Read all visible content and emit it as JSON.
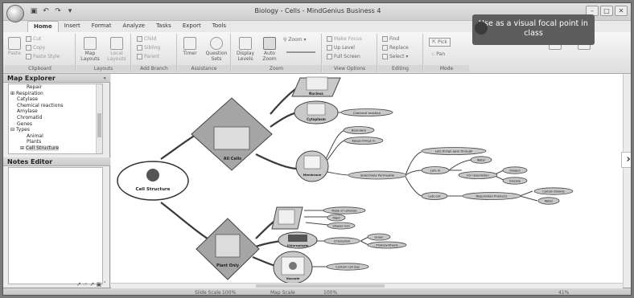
{
  "window": {
    "title": "Biology - Cells - MindGenius Business 4",
    "controls": [
      "–",
      "□",
      "✕"
    ]
  },
  "quick_access": [
    "save-icon",
    "undo-icon",
    "redo-icon"
  ],
  "tabs": [
    "Home",
    "Insert",
    "Format",
    "Analyze",
    "Tasks",
    "Export",
    "Tools"
  ],
  "ribbon": {
    "clipboard": {
      "paste": "Paste",
      "cut": "Cut",
      "copy": "Copy",
      "paste_style": "Paste Style",
      "label": "Clipboard"
    },
    "layouts": {
      "map_layouts": "Map Layouts",
      "local_layouts": "Local Layouts",
      "label": "Layouts"
    },
    "add_branch": {
      "child": "Child",
      "sibling": "Sibling",
      "parent": "Parent",
      "label": "Add Branch"
    },
    "assistance": {
      "timer": "Timer",
      "question_sets": "Question Sets",
      "label": "Assistance"
    },
    "zoom": {
      "display_levels": "Display Levels",
      "auto_zoom": "Auto Zoom",
      "zoom": "Zoom",
      "label": "Zoom"
    },
    "view_options": {
      "make_focus": "Make Focus",
      "up_level": "Up Level",
      "full_screen": "Full Screen",
      "label": "View Options"
    },
    "editing": {
      "find": "Find",
      "replace": "Replace",
      "select": "Select",
      "label": "Editing"
    },
    "mode": {
      "pick": "Pick",
      "pan": "Pan",
      "label": "Mode"
    }
  },
  "tooltip": "Use as a visual focal point in class",
  "map_explorer": {
    "title": "Map Explorer",
    "items": [
      {
        "label": "Repair",
        "indent": 1
      },
      {
        "label": "Respiration",
        "indent": 0,
        "expander": "⊞"
      },
      {
        "label": "Catylase",
        "indent": 0
      },
      {
        "label": "Chemical reactions",
        "indent": 0
      },
      {
        "label": "Amylase",
        "indent": 0
      },
      {
        "label": "Chromatid",
        "indent": 0
      },
      {
        "label": "Genes",
        "indent": 0
      },
      {
        "label": "Types",
        "indent": 0,
        "expander": "⊟"
      },
      {
        "label": "Animal",
        "indent": 1
      },
      {
        "label": "Plants",
        "indent": 1
      },
      {
        "label": "Cell Structure",
        "indent": 1,
        "expander": "⊞",
        "selected": true
      }
    ]
  },
  "notes_editor": {
    "title": "Notes Editor"
  },
  "left_footer": "↗ ☞ ↗ ▣ ˅",
  "mindmap": {
    "root": "Cell Structure",
    "all_cells": "All Cells",
    "plant_only": "Plant Only",
    "nucleus": "Nucleus",
    "cytoplasm": "Cytoplasm",
    "membrane": "Membrane",
    "chloroplasts": "Chloroplasts",
    "vacuole": "Vacuole",
    "chemical_reaction": "Chemical reaction",
    "boundary": "Boundary",
    "keeps_things_in": "Keeps things in",
    "selectively_permeable": "Selectively Permeable",
    "lets_things_pass": "Lets things pass through",
    "lets_in": "Lets in",
    "lets_out": "Lets out",
    "water_in": "Water",
    "for_respiration": "For respiration",
    "oxygen": "Oxygen",
    "glucose": "Glucose",
    "respiration_products": "Respiration Products",
    "carbon_dioxide": "Carbon Dioxide",
    "water_out": "Water",
    "made_of_cellulose": "Made of cellulose",
    "rigid": "Rigid",
    "shapes_cell": "Shapes Cell",
    "chlorophyll": "Chlorophyll",
    "green": "Green",
    "photosynthesis": "Photosynthesis",
    "contain_cell_sap": "Contain Cell Sap"
  },
  "status": {
    "slide_scale": "Slide Scale",
    "slide_scale_value": "100%",
    "map_scale": "Map Scale",
    "map_scale_value": "100%",
    "zoom_value": "41%"
  },
  "colors": {
    "accent_red": "#b12f2f",
    "node_grey": "#c9c9c9",
    "diamond": "#a5a5a5"
  }
}
